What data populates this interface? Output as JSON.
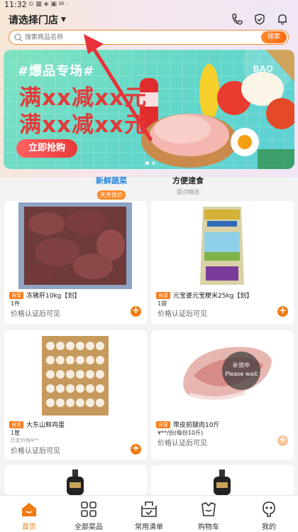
{
  "status": {
    "time": "11:32",
    "sys": "⊙ ▦ ◈ ▣ ✉ ·"
  },
  "header": {
    "store_label": "请选择门店"
  },
  "search": {
    "placeholder": "搜索商品名称",
    "button": "搜索"
  },
  "banner": {
    "tag": "#爆品专场#",
    "line1": "满xx减xx元",
    "line2": "满xx减xx元",
    "cta": "立即抢购",
    "brand": "BAO"
  },
  "tabs": [
    {
      "title": "新鲜蔬菜",
      "subtitle": "天天低价",
      "active": true
    },
    {
      "title": "方便速食",
      "subtitle": "面点精选",
      "active": false
    }
  ],
  "products": [
    {
      "badge": "自营",
      "name": "冻猪肝10kg【划】",
      "unit": "1件",
      "price": "价格认证后可见",
      "image": "frozen-liver-image"
    },
    {
      "badge": "自营",
      "name": "元宝婆元宝粳米25kg【划】",
      "unit": "1袋",
      "price": "价格认证后可见",
      "image": "rice-bag-image"
    },
    {
      "badge": "自营",
      "name": "大东山鲜鸡蛋",
      "unit": "1筐",
      "note": "历史价格¥**",
      "price": "价格认证后可见",
      "image": "egg-crate-image"
    },
    {
      "badge": "自营",
      "name": "带皮前腿肉10斤",
      "unit": "¥**/份(每份10斤)",
      "price": "价格认证后可见",
      "image": "pork-leg-image",
      "out_of_stock": {
        "cn": "补货中",
        "en": "Please wait"
      }
    }
  ],
  "tabbar": [
    {
      "label": "首页",
      "icon": "home-icon",
      "active": true
    },
    {
      "label": "全部菜品",
      "icon": "grid-icon",
      "active": false
    },
    {
      "label": "常用清单",
      "icon": "list-box-icon",
      "active": false
    },
    {
      "label": "购物车",
      "icon": "cart-icon",
      "active": false
    },
    {
      "label": "我的",
      "icon": "user-icon",
      "active": false
    }
  ],
  "colors": {
    "accent": "#f07b14",
    "tab_active": "#2a86d8",
    "banner_red": "#e23b3b"
  }
}
